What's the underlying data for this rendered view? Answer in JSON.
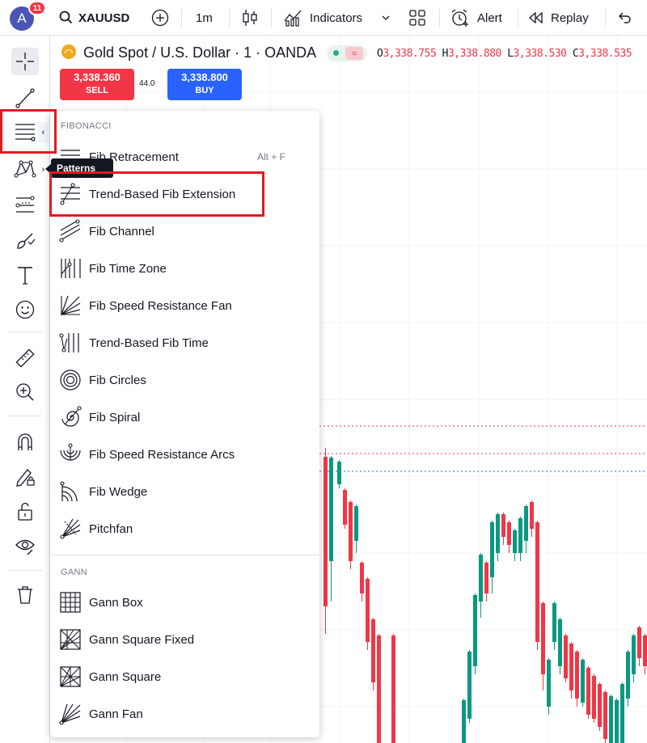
{
  "topbar": {
    "avatar_letter": "A",
    "notification_count": "11",
    "symbol": "XAUUSD",
    "interval": "1m",
    "indicators_label": "Indicators",
    "alert_label": "Alert",
    "replay_label": "Replay"
  },
  "legend": {
    "title": "Gold Spot / U.S. Dollar · 1 · OANDA",
    "open_key": "O",
    "open_val": "3,338.755",
    "high_key": "H",
    "high_val": "3,338.880",
    "low_key": "L",
    "low_val": "3,338.530",
    "close_key": "C",
    "close_val": "3,338.535"
  },
  "trade": {
    "sell_price": "3,338.360",
    "sell_label": "SELL",
    "spread": "44.0",
    "buy_price": "3,338.800",
    "buy_label": "BUY"
  },
  "tooltip": "Patterns",
  "menu": {
    "fib_section": "FIBONACCI",
    "gann_section": "GANN",
    "fib_items": [
      {
        "label": "Fib Retracement",
        "shortcut": "Alt + F",
        "icon": "fib-retracement-icon"
      },
      {
        "label": "Trend-Based Fib Extension",
        "icon": "trend-fib-extension-icon"
      },
      {
        "label": "Fib Channel",
        "icon": "fib-channel-icon"
      },
      {
        "label": "Fib Time Zone",
        "icon": "fib-time-zone-icon"
      },
      {
        "label": "Fib Speed Resistance Fan",
        "icon": "fib-speed-fan-icon"
      },
      {
        "label": "Trend-Based Fib Time",
        "icon": "trend-fib-time-icon"
      },
      {
        "label": "Fib Circles",
        "icon": "fib-circles-icon"
      },
      {
        "label": "Fib Spiral",
        "icon": "fib-spiral-icon"
      },
      {
        "label": "Fib Speed Resistance Arcs",
        "icon": "fib-speed-arcs-icon"
      },
      {
        "label": "Fib Wedge",
        "icon": "fib-wedge-icon"
      },
      {
        "label": "Pitchfan",
        "icon": "pitchfan-icon"
      }
    ],
    "gann_items": [
      {
        "label": "Gann Box",
        "icon": "gann-box-icon"
      },
      {
        "label": "Gann Square Fixed",
        "icon": "gann-square-fixed-icon"
      },
      {
        "label": "Gann Square",
        "icon": "gann-square-icon"
      },
      {
        "label": "Gann Fan",
        "icon": "gann-fan-icon"
      }
    ]
  },
  "colors": {
    "up": "#089981",
    "down": "#f23645",
    "sell_bg": "#f23645",
    "buy_bg": "#2962ff",
    "highlight": "#e01b22"
  }
}
